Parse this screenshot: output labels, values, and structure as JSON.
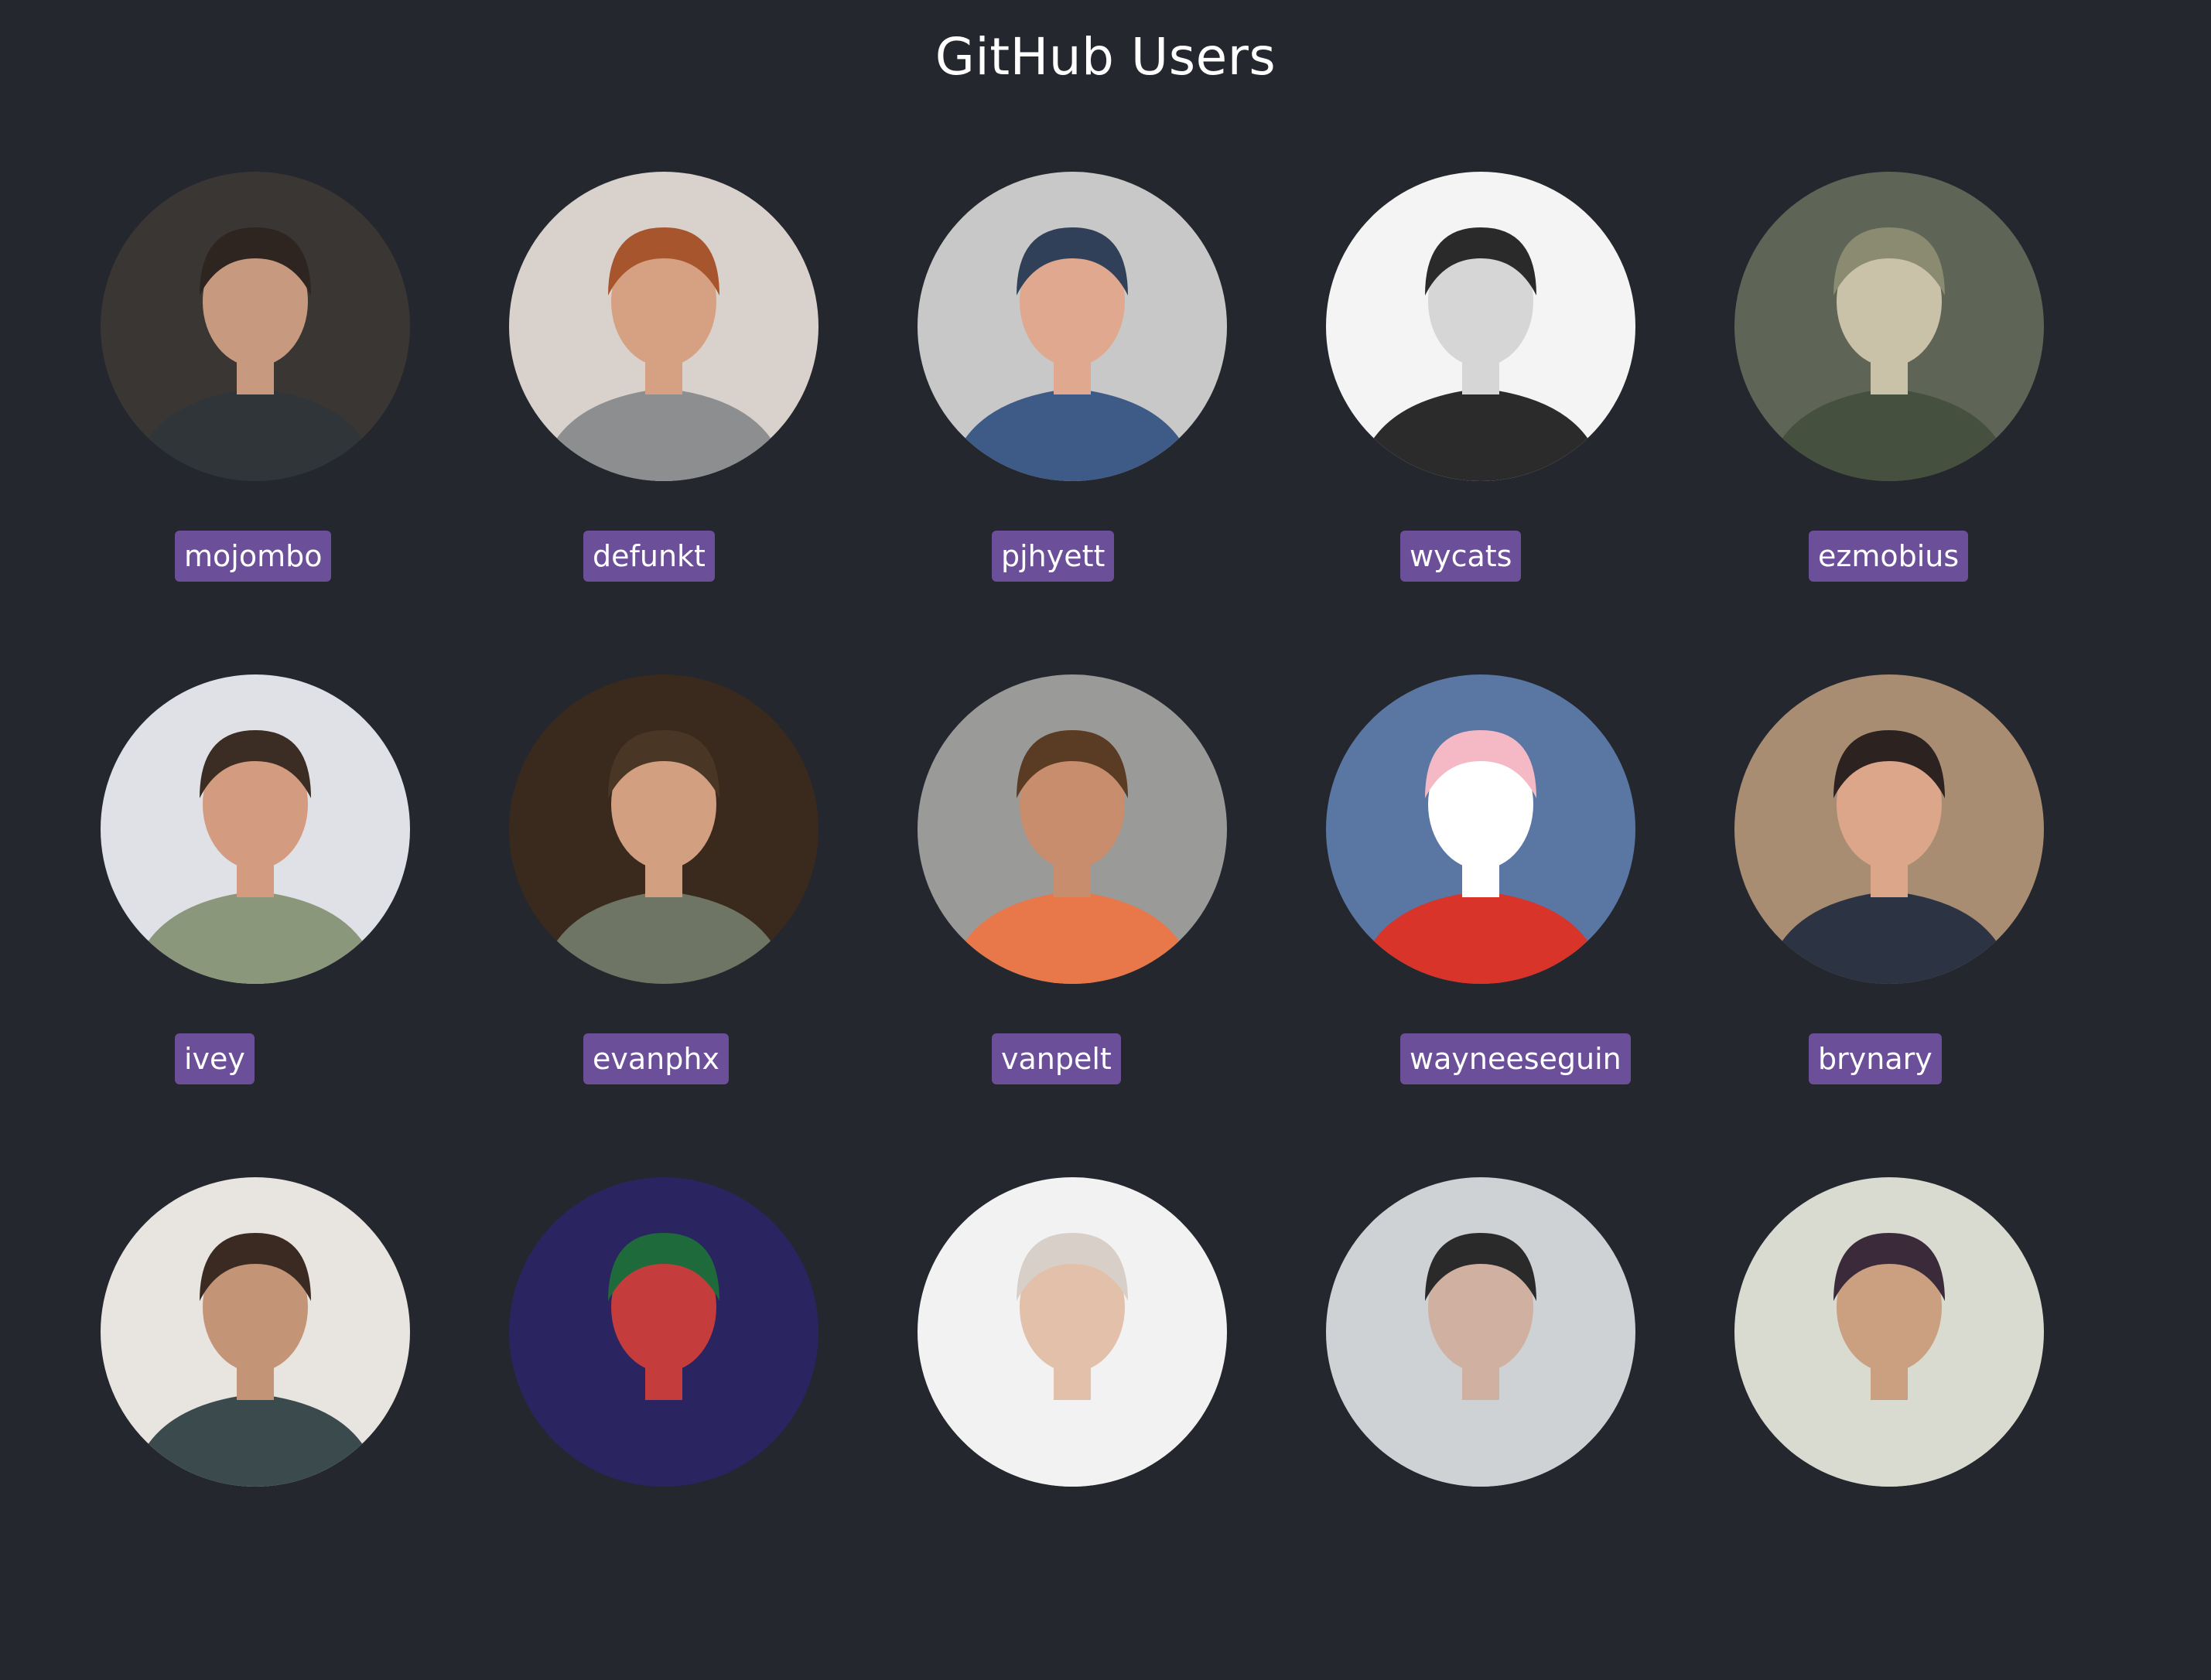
{
  "page": {
    "title": "GitHub Users",
    "background": "#24272e",
    "badge_color": "#6b4f98"
  },
  "users": [
    {
      "login": "mojombo",
      "avatar_icon": "person-photo",
      "bg": "#3a3634",
      "skin": "#c79a80",
      "hair": "#2e2420",
      "shirt": "#2f3538"
    },
    {
      "login": "defunkt",
      "avatar_icon": "person-sunglasses-photo",
      "bg": "#d9d2cc",
      "skin": "#d6a183",
      "hair": "#a7552c",
      "shirt": "#8c8e8f"
    },
    {
      "login": "pjhyett",
      "avatar_icon": "person-cap-photo",
      "bg": "#c8c8c8",
      "skin": "#e0a98f",
      "hair": "#2f4058",
      "shirt": "#3e5a86"
    },
    {
      "login": "wycats",
      "avatar_icon": "person-bw-photo",
      "bg": "#f4f4f4",
      "skin": "#d6d6d6",
      "hair": "#2a2a2a",
      "shirt": "#2b2b2b"
    },
    {
      "login": "ezmobius",
      "avatar_icon": "alien-drawing",
      "bg": "#5e6456",
      "skin": "#c9c1a8",
      "hair": "#8a8b70",
      "shirt": "#45503f"
    },
    {
      "login": "ivey",
      "avatar_icon": "person-looking-down-photo",
      "bg": "#dfe1e6",
      "skin": "#d39b7f",
      "hair": "#3b2c24",
      "shirt": "#8a977b"
    },
    {
      "login": "evanphx",
      "avatar_icon": "person-talking-photo",
      "bg": "#3a2a1d",
      "skin": "#d2a080",
      "hair": "#4a3624",
      "shirt": "#6e7565"
    },
    {
      "login": "vanpelt",
      "avatar_icon": "person-windows-logo-photo",
      "bg": "#9a9a98",
      "skin": "#c88d6c",
      "hair": "#5a3b23",
      "shirt": "#e8774a"
    },
    {
      "login": "wayneeseguin",
      "avatar_icon": "cartoon-mouse-icon",
      "bg": "#5a77a3",
      "skin": "#ffffff",
      "hair": "#f4b9c4",
      "shirt": "#d8342a"
    },
    {
      "login": "brynary",
      "avatar_icon": "person-glasses-photo",
      "bg": "#a98d73",
      "skin": "#dba68a",
      "hair": "#2c2220",
      "shirt": "#2c3444"
    },
    {
      "login": "",
      "avatar_icon": "person-photo",
      "bg": "#e8e4e0",
      "skin": "#c49476",
      "hair": "#3a2a22",
      "shirt": "#3b4a4c"
    },
    {
      "login": "",
      "avatar_icon": "person-photo",
      "bg": "#2a2460",
      "skin": "#c43c3c",
      "hair": "#1f6a3a",
      "shirt": "#2a2460"
    },
    {
      "login": "",
      "avatar_icon": "person-photo",
      "bg": "#f2f2f2",
      "skin": "#e2c0aa",
      "hair": "#d8d0c8",
      "shirt": "#f2f2f2"
    },
    {
      "login": "",
      "avatar_icon": "person-photo",
      "bg": "#cfd2d4",
      "skin": "#d0b0a0",
      "hair": "#2a2a2a",
      "shirt": "#cfd2d4"
    },
    {
      "login": "",
      "avatar_icon": "person-photo",
      "bg": "#d9dad0",
      "skin": "#caa080",
      "hair": "#3a2a3a",
      "shirt": "#d9dad0"
    }
  ]
}
